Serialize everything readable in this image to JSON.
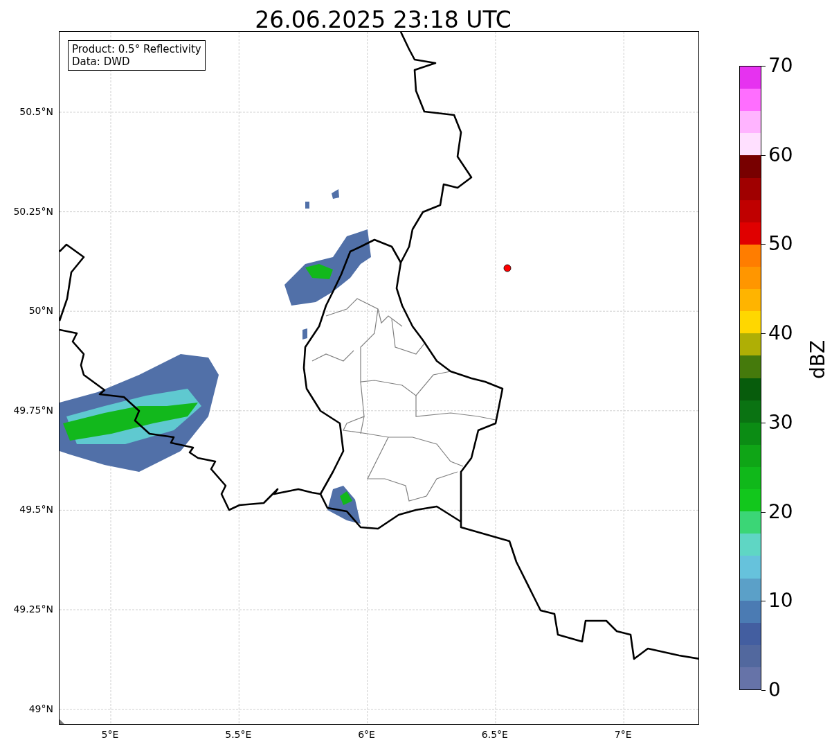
{
  "title": "26.06.2025 23:18 UTC",
  "info_box": {
    "lines": [
      "Product: 0.5° Reflectivity",
      "Data: DWD"
    ]
  },
  "map": {
    "lat_ticks": [
      "50.5°N",
      "50.25°N",
      "50°N",
      "49.75°N",
      "49.5°N",
      "49.25°N",
      "49°N"
    ],
    "lon_ticks": [
      "5°E",
      "5.5°E",
      "6°E",
      "6.5°E",
      "7°E"
    ]
  },
  "colorbar": {
    "label": "dBZ",
    "ticks": [
      "70",
      "60",
      "50",
      "40",
      "30",
      "20",
      "10",
      "0"
    ],
    "bands": [
      {
        "color": "#e632f0"
      },
      {
        "color": "#ff6eff"
      },
      {
        "color": "#ffb4ff"
      },
      {
        "color": "#ffe0ff"
      },
      {
        "color": "#780000"
      },
      {
        "color": "#a00000"
      },
      {
        "color": "#c00000"
      },
      {
        "color": "#e00000"
      },
      {
        "color": "#ff7d00"
      },
      {
        "color": "#ff9600"
      },
      {
        "color": "#ffb400"
      },
      {
        "color": "#ffd700"
      },
      {
        "color": "#afaf05"
      },
      {
        "color": "#457a0c"
      },
      {
        "color": "#075c0c"
      },
      {
        "color": "#0a7312"
      },
      {
        "color": "#0b8c14"
      },
      {
        "color": "#0fa516"
      },
      {
        "color": "#10b81a"
      },
      {
        "color": "#12c71c"
      },
      {
        "color": "#3bd676"
      },
      {
        "color": "#5fd6c4"
      },
      {
        "color": "#66c2dc"
      },
      {
        "color": "#5ba0c8"
      },
      {
        "color": "#4b7bb3"
      },
      {
        "color": "#435ea0"
      },
      {
        "color": "#52689e"
      },
      {
        "color": "#6673a8"
      }
    ]
  }
}
